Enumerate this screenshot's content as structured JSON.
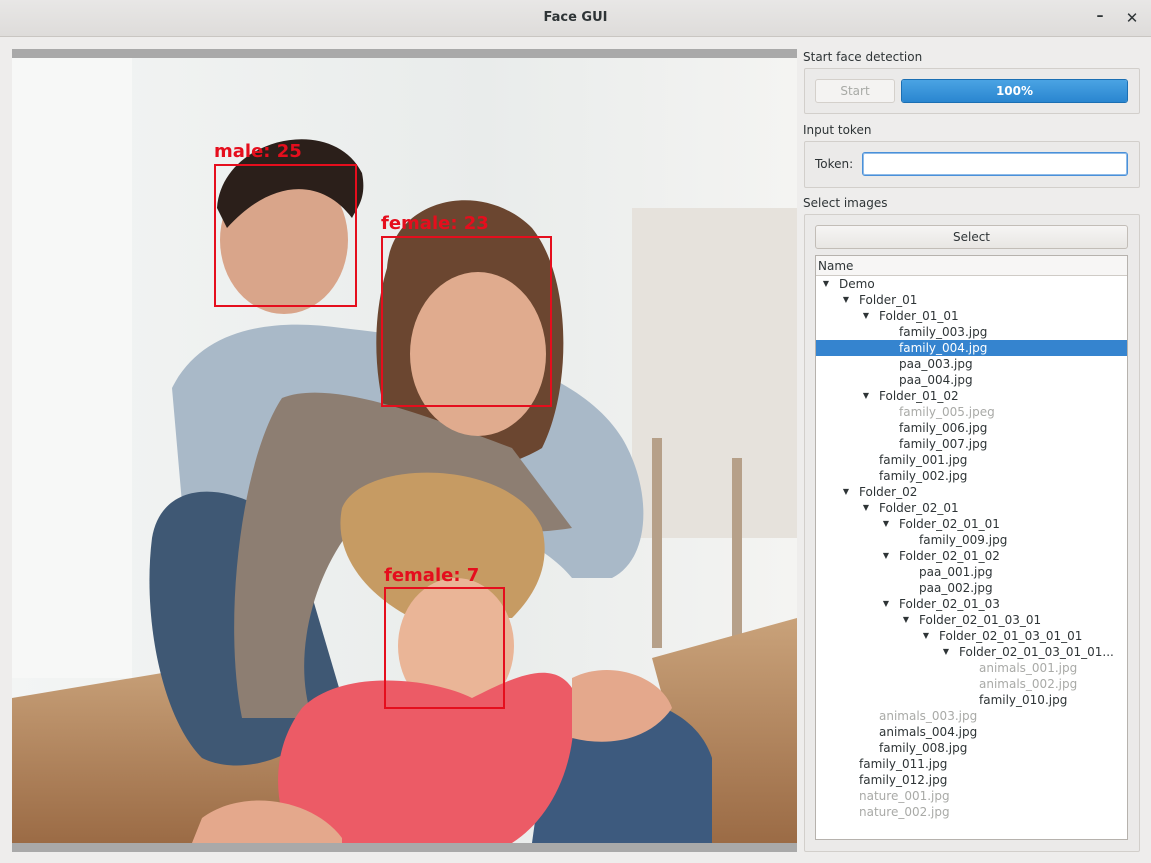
{
  "window": {
    "title": "Face GUI",
    "minimize": "–",
    "close": "✕"
  },
  "detection": {
    "section_title": "Start face detection",
    "start_label": "Start",
    "progress_text": "100%",
    "progress_value": 1.0
  },
  "token": {
    "section_title": "Input token",
    "label": "Token:",
    "value": ""
  },
  "images": {
    "section_title": "Select images",
    "select_label": "Select",
    "column_header": "Name"
  },
  "faces": [
    {
      "label": "male: 25"
    },
    {
      "label": "female: 23"
    },
    {
      "label": "female: 7"
    }
  ],
  "tree": [
    {
      "label": "Demo",
      "depth": 0,
      "expanded": true,
      "folder": true
    },
    {
      "label": "Folder_01",
      "depth": 1,
      "expanded": true,
      "folder": true
    },
    {
      "label": "Folder_01_01",
      "depth": 2,
      "expanded": true,
      "folder": true
    },
    {
      "label": "family_003.jpg",
      "depth": 3
    },
    {
      "label": "family_004.jpg",
      "depth": 3,
      "selected": true
    },
    {
      "label": "paa_003.jpg",
      "depth": 3
    },
    {
      "label": "paa_004.jpg",
      "depth": 3
    },
    {
      "label": "Folder_01_02",
      "depth": 2,
      "expanded": true,
      "folder": true
    },
    {
      "label": "family_005.jpeg",
      "depth": 3,
      "dim": true
    },
    {
      "label": "family_006.jpg",
      "depth": 3
    },
    {
      "label": "family_007.jpg",
      "depth": 3
    },
    {
      "label": "family_001.jpg",
      "depth": 2
    },
    {
      "label": "family_002.jpg",
      "depth": 2
    },
    {
      "label": "Folder_02",
      "depth": 1,
      "expanded": true,
      "folder": true
    },
    {
      "label": "Folder_02_01",
      "depth": 2,
      "expanded": true,
      "folder": true
    },
    {
      "label": "Folder_02_01_01",
      "depth": 3,
      "expanded": true,
      "folder": true
    },
    {
      "label": "family_009.jpg",
      "depth": 4
    },
    {
      "label": "Folder_02_01_02",
      "depth": 3,
      "expanded": true,
      "folder": true
    },
    {
      "label": "paa_001.jpg",
      "depth": 4
    },
    {
      "label": "paa_002.jpg",
      "depth": 4
    },
    {
      "label": "Folder_02_01_03",
      "depth": 3,
      "expanded": true,
      "folder": true
    },
    {
      "label": "Folder_02_01_03_01",
      "depth": 4,
      "expanded": true,
      "folder": true
    },
    {
      "label": "Folder_02_01_03_01_01",
      "depth": 5,
      "expanded": true,
      "folder": true
    },
    {
      "label": "Folder_02_01_03_01_01...",
      "depth": 6,
      "expanded": true,
      "folder": true
    },
    {
      "label": "animals_001.jpg",
      "depth": 7,
      "dim": true
    },
    {
      "label": "animals_002.jpg",
      "depth": 7,
      "dim": true
    },
    {
      "label": "family_010.jpg",
      "depth": 7
    },
    {
      "label": "animals_003.jpg",
      "depth": 2,
      "dim": true
    },
    {
      "label": "animals_004.jpg",
      "depth": 2
    },
    {
      "label": "family_008.jpg",
      "depth": 2
    },
    {
      "label": "family_011.jpg",
      "depth": 1
    },
    {
      "label": "family_012.jpg",
      "depth": 1
    },
    {
      "label": "nature_001.jpg",
      "depth": 1,
      "dim": true
    },
    {
      "label": "nature_002.jpg",
      "depth": 1,
      "dim": true
    }
  ],
  "colors": {
    "accent": "#3584cf",
    "box": "#e50e1d",
    "progress": "#2a86d0"
  }
}
